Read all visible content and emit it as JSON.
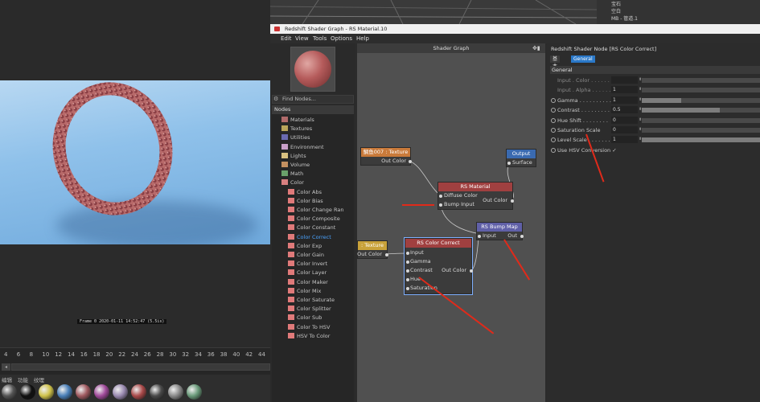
{
  "object_manager": {
    "rows": [
      "宝石",
      "空白",
      "MB - 管道.1"
    ]
  },
  "viewport": {
    "frame_info": "Frame  0   2020-01-11  14:52:47  (5.5is)"
  },
  "timeline": {
    "ticks": [
      "4",
      "6",
      "8",
      "10",
      "12",
      "14",
      "16",
      "18",
      "20",
      "22",
      "24",
      "26",
      "28",
      "30",
      "32",
      "34",
      "36",
      "38",
      "40",
      "42",
      "44"
    ],
    "scroll_button": "◂"
  },
  "material_bar": {
    "menu": [
      "编辑",
      "功能",
      "纹理"
    ],
    "swatch_colors": [
      "#555",
      "#111",
      "#cfc24a",
      "#4a7fb8",
      "#a05a60",
      "#a04a9a",
      "#9a8ab0",
      "#aa4a4a",
      "#4a4a4a",
      "#8a8a8a",
      "#6a9a7a"
    ]
  },
  "window": {
    "title": "Redshift Shader Graph - RS Material.10",
    "menu": [
      "Edit",
      "View",
      "Tools",
      "Options",
      "Help"
    ]
  },
  "sidebar": {
    "find_placeholder": "Find Nodes...",
    "find_icon": "⚙",
    "nodes_header": "Nodes",
    "categories": [
      {
        "label": "Materials",
        "color": "#b06a6a"
      },
      {
        "label": "Textures",
        "color": "#b8a45a"
      },
      {
        "label": "Utilities",
        "color": "#6a6ab0"
      },
      {
        "label": "Environment",
        "color": "#c9a0c9"
      },
      {
        "label": "Lights",
        "color": "#d8c080"
      },
      {
        "label": "Volume",
        "color": "#c49060"
      },
      {
        "label": "Math",
        "color": "#6aa06a"
      },
      {
        "label": "Color",
        "color": "#d88080"
      }
    ],
    "color_nodes": [
      "Color Abs",
      "Color Bias",
      "Color Change Ran",
      "Color Composite",
      "Color Constant",
      "Color Correct",
      "Color Exp",
      "Color Gain",
      "Color Invert",
      "Color Layer",
      "Color Maker",
      "Color Mix",
      "Color Saturate",
      "Color Splitter",
      "Color Sub",
      "Color To HSV",
      "HSV To Color"
    ],
    "selected": "Color Correct",
    "color_node_swatch": "#e07a7a"
  },
  "canvas": {
    "title": "Shader Graph",
    "grip": "✥▮",
    "nodes": {
      "texture1": {
        "title": "鲷鱼007 : Texture",
        "out": "Out Color",
        "color": "#c97a3a"
      },
      "texture2": {
        "title": ": Texture",
        "out": "Out Color",
        "color": "#c9a23a"
      },
      "output": {
        "title": "Output",
        "in": "Surface",
        "color": "#3a6ab0"
      },
      "rs_material": {
        "title": "RS Material",
        "in1": "Diffuse Color",
        "in2": "Bump Input",
        "out": "Out Color",
        "color": "#a04040"
      },
      "bump_map": {
        "title": "RS Bump Map",
        "in": "Input",
        "out": "Out",
        "color": "#6060a8"
      },
      "color_correct": {
        "title": "RS Color Correct",
        "inputs": [
          "Input",
          "Gamma",
          "Contrast",
          "Hue",
          "Saturation"
        ],
        "out": "Out Color",
        "color": "#a04040"
      }
    }
  },
  "attributes": {
    "title": "Redshift Shader Node [RS Color Correct]",
    "tabs": [
      "基本",
      "General"
    ],
    "active_tab": "General",
    "group": "General",
    "params": [
      {
        "label": "Input . Color . . . . . .",
        "value": "",
        "enabled": false,
        "fill": 0
      },
      {
        "label": "Input . Alpha . . . . . .",
        "value": "1",
        "enabled": false,
        "fill": 0
      },
      {
        "label": "Gamma . . . . . . . . . .",
        "value": "1",
        "enabled": true,
        "fill": 0.33
      },
      {
        "label": "Contrast . . . . . . . . .",
        "value": "0.5",
        "enabled": true,
        "fill": 0.66
      },
      {
        "label": "Hue Shift . . . . . . . .",
        "value": "0",
        "enabled": true,
        "fill": 0
      },
      {
        "label": "Saturation Scale",
        "value": "0",
        "enabled": true,
        "fill": 0
      },
      {
        "label": "Level Scale . . . . . . .",
        "value": "1",
        "enabled": true,
        "fill": 1
      },
      {
        "label": "Use HSV Conversion ✓",
        "value": "",
        "enabled": true,
        "fill": 0
      }
    ]
  }
}
